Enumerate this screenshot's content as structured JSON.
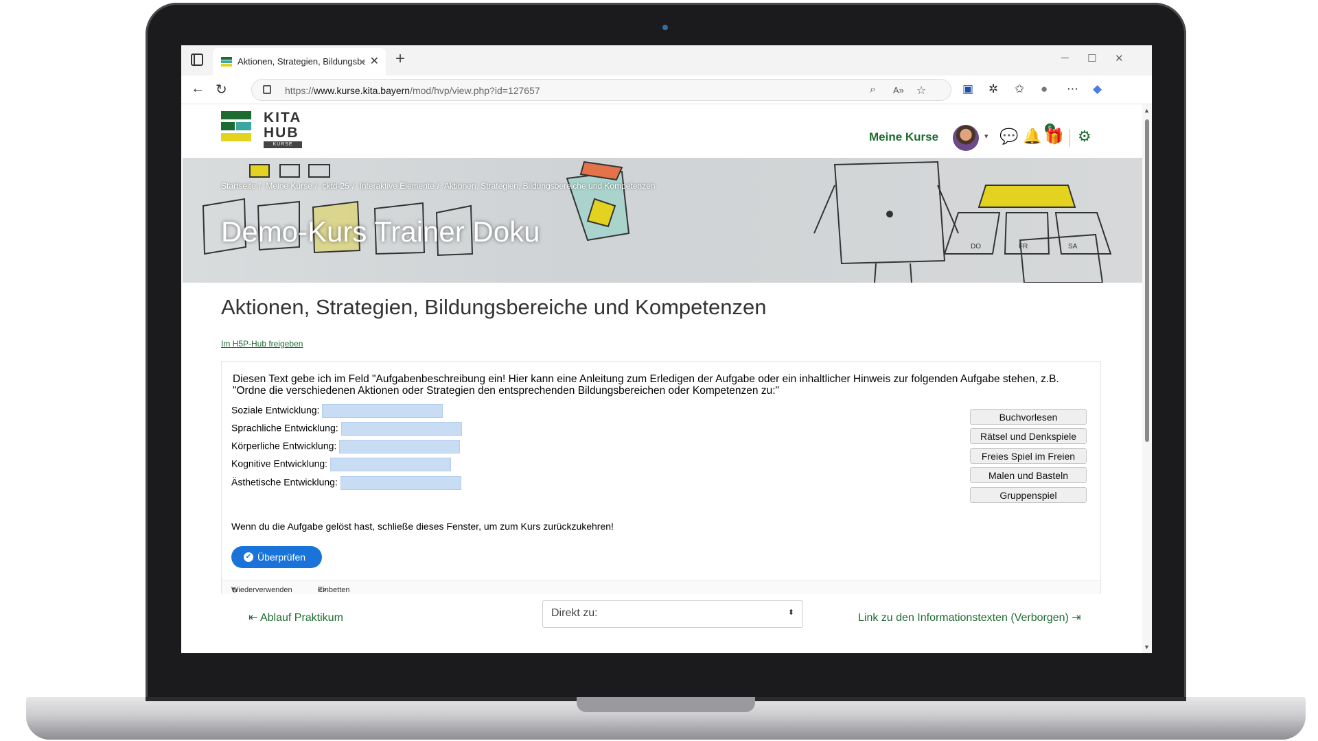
{
  "browser": {
    "tab_title": "Aktionen, Strategien, Bildungsbereiche",
    "url_prefix": "https://",
    "url_host": "www.kurse.kita.bayern",
    "url_path": "/mod/hvp/view.php?id=127657"
  },
  "site": {
    "logo_line1": "KITA",
    "logo_line2": "HUB",
    "logo_badge": "KURSE",
    "nav_my_courses": "Meine Kurse",
    "notification_count": "5",
    "brand_green": "#1e6b32"
  },
  "banner": {
    "breadcrumb": [
      "Startseite",
      "Meine Kurse",
      "cktd-25",
      "Interaktive Elemente",
      "Aktionen, Strategien, Bildungsbereiche und Kompetenzen"
    ],
    "course_title": "Demo-Kurs Trainer Doku"
  },
  "page": {
    "heading": "Aktionen, Strategien, Bildungsbereiche und Kompetenzen",
    "h5p_link": "Im H5P-Hub freigeben"
  },
  "activity": {
    "description": "Diesen Text gebe ich im Feld \"Aufgabenbeschreibung ein! Hier kann eine Anleitung zum Erledigen der Aufgabe oder ein inhaltlicher Hinweis zur folgenden Aufgabe stehen, z.B. \"Ordne die verschiedenen Aktionen oder Strategien den entsprechenden Bildungsbereichen oder Kompetenzen zu:\"",
    "blanks": [
      {
        "label": "Soziale Entwicklung:"
      },
      {
        "label": "Sprachliche Entwicklung:"
      },
      {
        "label": "Körperliche Entwicklung:"
      },
      {
        "label": "Kognitive Entwicklung:"
      },
      {
        "label": "Ästhetische Entwicklung:"
      }
    ],
    "draggables": [
      "Buchvorlesen",
      "Rätsel und Denkspiele",
      "Freies Spiel im Freien",
      "Malen und Basteln",
      "Gruppenspiel"
    ],
    "finish_note": "Wenn du die Aufgabe gelöst hast, schließe dieses Fenster, um zum Kurs zurückzukehren!",
    "check_button": "Überprüfen",
    "footer_reuse": "Wiederverwenden",
    "footer_embed": "Einbetten"
  },
  "navigation": {
    "prev_link": "Ablauf Praktikum",
    "jump_placeholder": "Direkt zu:",
    "next_link": "Link zu den Informationstexten (Verborgen)"
  }
}
